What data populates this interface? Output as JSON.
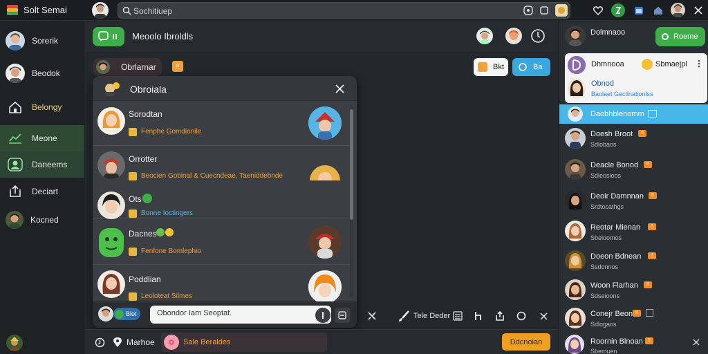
{
  "app": {
    "title": "Solt Semai"
  },
  "search": {
    "placeholder": "Sochitiuep"
  },
  "sidebar": {
    "items": [
      {
        "label": "Sorerik",
        "icon": "avatar-icon"
      },
      {
        "label": "Beodok",
        "icon": "avatar-icon"
      },
      {
        "label": "Belongy",
        "icon": "home-icon"
      },
      {
        "label": "Meone",
        "icon": "chart-icon",
        "active": true
      },
      {
        "label": "Daneems",
        "icon": "people-icon",
        "active": true
      },
      {
        "label": "Deciart",
        "icon": "export-icon"
      },
      {
        "label": "Kocned",
        "icon": "avatar-icon"
      }
    ]
  },
  "header": {
    "title": "Meoolo Ibroldls"
  },
  "chip": {
    "label": "Obrlarnar",
    "badge": "!!"
  },
  "pill_buttons": {
    "first": "Bkt",
    "second": "Ba"
  },
  "dialog": {
    "title": "Obroiala",
    "rows": [
      {
        "name": "Sorodtan",
        "sub": "Fenphe Gomdionile",
        "sub_color": "orange"
      },
      {
        "name": "Orrotter",
        "sub": "Beocien Gobinal & Cuecndeae, Taeniddebnde",
        "sub_color": "orange"
      },
      {
        "name": "Ots",
        "sub": "Bonne Ioctingers",
        "sub_color": "blue"
      },
      {
        "name": "Dacnes",
        "sub": "Fenfone Bomlephio",
        "sub_color": "orange"
      },
      {
        "name": "Poddlian",
        "sub": "Leoloteat Silmes",
        "sub_color": "orange"
      }
    ],
    "input_placeholder": "Obondor Iam Seoptat.",
    "foot_chip": "Blot"
  },
  "toolbar": {
    "label": "Tele Deder"
  },
  "bottom": {
    "left_label": "Marhoe",
    "chip_label": "Sale Beraldes",
    "action_button": "Ddcnoian"
  },
  "right_panel": {
    "top": {
      "name": "Dolmnaoo",
      "button": "Roeme"
    },
    "popup": {
      "name": "Dhmnooa",
      "tag": "Sbmaejpl",
      "name2": "Obnod",
      "sub2": "Baolaet Gectlnationlss"
    },
    "rows": [
      {
        "name": "Daobhblenomm",
        "sub": "",
        "selected": true
      },
      {
        "name": "Doesh Broot",
        "sub": "Sdlobaos",
        "badge": "!!"
      },
      {
        "name": "Deacle Bonod",
        "sub": "Sdleosioos",
        "badge": "!!"
      },
      {
        "name": "Deoir Damnnan",
        "sub": "Srdtocathgs",
        "badge": "!!"
      },
      {
        "name": "Reotar Mienan",
        "sub": "Sbeloomos",
        "badge": "!!"
      },
      {
        "name": "Doeon Bdnean",
        "sub": "Ssdonnos",
        "badge": "!!"
      },
      {
        "name": "Woon Flarhan",
        "sub": "Sdseioons",
        "badge": "!!"
      },
      {
        "name": "Conejr Beon",
        "sub": "Sdlogaos",
        "badge": "!!"
      },
      {
        "name": "Roornin Blnoan",
        "sub": "Sbemuen",
        "badge": "!!"
      }
    ]
  },
  "colors": {
    "accent_green": "#3fae4a",
    "accent_blue": "#3aa7e0",
    "accent_orange": "#f0a23a",
    "selected_row": "#47b6e8"
  }
}
